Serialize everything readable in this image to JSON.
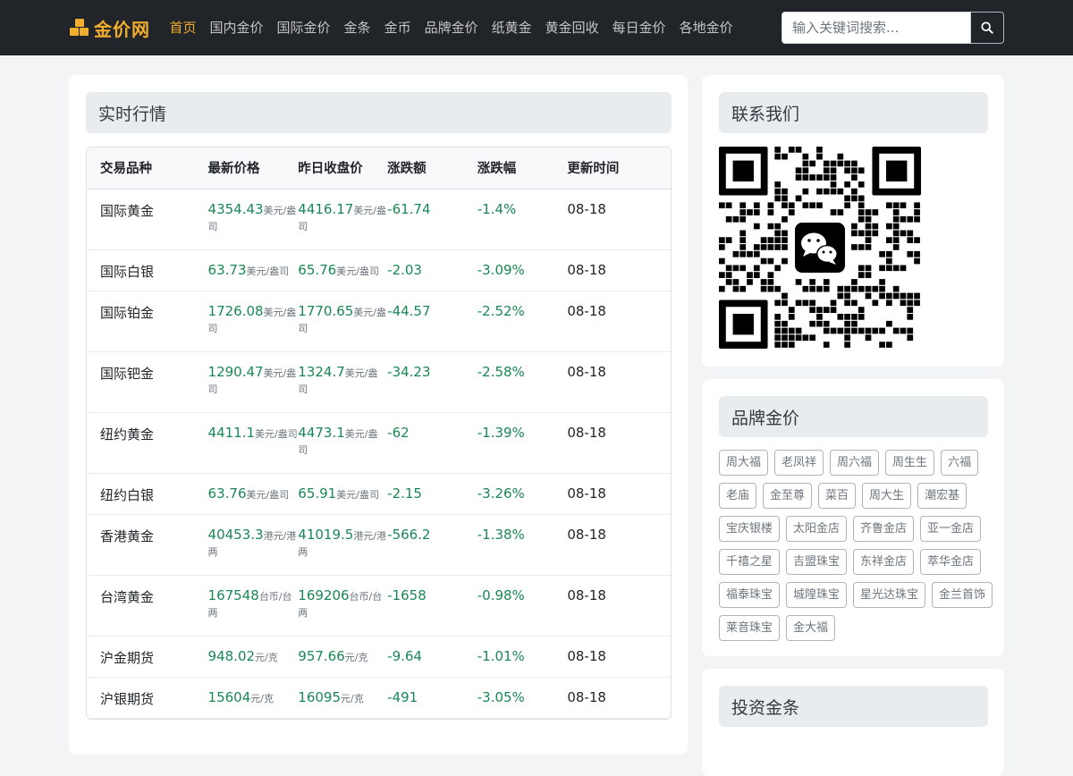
{
  "brand": {
    "name": "金价网"
  },
  "nav": [
    {
      "label": "首页",
      "active": true
    },
    {
      "label": "国内金价"
    },
    {
      "label": "国际金价"
    },
    {
      "label": "金条"
    },
    {
      "label": "金币"
    },
    {
      "label": "品牌金价"
    },
    {
      "label": "纸黄金"
    },
    {
      "label": "黄金回收"
    },
    {
      "label": "每日金价"
    },
    {
      "label": "各地金价"
    }
  ],
  "search": {
    "placeholder": "输入关键词搜索...",
    "value": ""
  },
  "market": {
    "title": "实时行情",
    "headers": [
      "交易品种",
      "最新价格",
      "昨日收盘价",
      "涨跌额",
      "涨跌幅",
      "更新时间"
    ],
    "rows": [
      {
        "name": "国际黄金",
        "latest": "4354.43",
        "latest_unit": "美元/盎司",
        "prev": "4416.17",
        "prev_unit": "美元/盎司",
        "change": "-61.74",
        "pct": "-1.4%",
        "time": "08-18",
        "tall": true
      },
      {
        "name": "国际白银",
        "latest": "63.73",
        "latest_unit": "美元/盎司",
        "prev": "65.76",
        "prev_unit": "美元/盎司",
        "change": "-2.03",
        "pct": "-3.09%",
        "time": "08-18",
        "tall": false
      },
      {
        "name": "国际铂金",
        "latest": "1726.08",
        "latest_unit": "美元/盎司",
        "prev": "1770.65",
        "prev_unit": "美元/盎司",
        "change": "-44.57",
        "pct": "-2.52%",
        "time": "08-18",
        "tall": true
      },
      {
        "name": "国际钯金",
        "latest": "1290.47",
        "latest_unit": "美元/盎司",
        "prev": "1324.7",
        "prev_unit": "美元/盎司",
        "change": "-34.23",
        "pct": "-2.58%",
        "time": "08-18",
        "tall": true
      },
      {
        "name": "纽约黄金",
        "latest": "4411.1",
        "latest_unit": "美元/盎司",
        "prev": "4473.1",
        "prev_unit": "美元/盎司",
        "change": "-62",
        "pct": "-1.39%",
        "time": "08-18",
        "tall": true
      },
      {
        "name": "纽约白银",
        "latest": "63.76",
        "latest_unit": "美元/盎司",
        "prev": "65.91",
        "prev_unit": "美元/盎司",
        "change": "-2.15",
        "pct": "-3.26%",
        "time": "08-18",
        "tall": false
      },
      {
        "name": "香港黄金",
        "latest": "40453.3",
        "latest_unit": "港元/港两",
        "prev": "41019.5",
        "prev_unit": "港元/港两",
        "change": "-566.2",
        "pct": "-1.38%",
        "time": "08-18",
        "tall": true
      },
      {
        "name": "台湾黄金",
        "latest": "167548",
        "latest_unit": "台币/台两",
        "prev": "169206",
        "prev_unit": "台币/台两",
        "change": "-1658",
        "pct": "-0.98%",
        "time": "08-18",
        "tall": true
      },
      {
        "name": "沪金期货",
        "latest": "948.02",
        "latest_unit": "元/克",
        "prev": "957.66",
        "prev_unit": "元/克",
        "change": "-9.64",
        "pct": "-1.01%",
        "time": "08-18",
        "tall": false
      },
      {
        "name": "沪银期货",
        "latest": "15604",
        "latest_unit": "元/克",
        "prev": "16095",
        "prev_unit": "元/克",
        "change": "-491",
        "pct": "-3.05%",
        "time": "08-18",
        "tall": false
      }
    ]
  },
  "contact": {
    "title": "联系我们",
    "qr_icon": "wechat-icon"
  },
  "brands": {
    "title": "品牌金价",
    "items": [
      "周大福",
      "老凤祥",
      "周六福",
      "周生生",
      "六福",
      "老庙",
      "金至尊",
      "菜百",
      "周大生",
      "潮宏基",
      "宝庆银楼",
      "太阳金店",
      "齐鲁金店",
      "亚一金店",
      "千禧之星",
      "吉盟珠宝",
      "东祥金店",
      "萃华金店",
      "福泰珠宝",
      "城隍珠宝",
      "星光达珠宝",
      "金兰首饰",
      "莱音珠宝",
      "金大福"
    ]
  },
  "invest": {
    "title": "投资金条"
  },
  "colors": {
    "accent": "#f0ad2e",
    "navbar": "#212529",
    "positive_text": "#198754"
  }
}
